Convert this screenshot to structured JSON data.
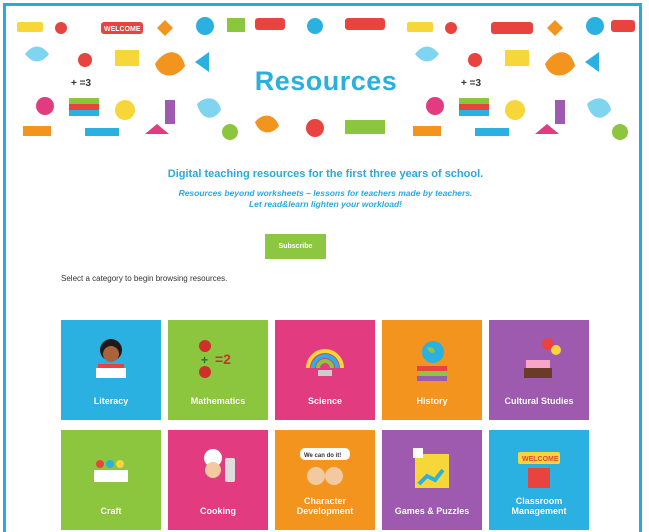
{
  "banner": {
    "title": "Resources",
    "stickers": [
      "WELCOME",
      "WELCOME",
      "WELCOME",
      "WELCOME",
      "WELCOME",
      "WELCOME"
    ],
    "brand": "read&learn"
  },
  "intro": {
    "tagline": "Digital teaching resources for the first three years of school.",
    "subtag_line1": "Resources beyond worksheets – lessons for teachers made by teachers.",
    "subtag_line2": "Let read&learn lighten your workload!"
  },
  "subscribe_label": "Subscribe",
  "select_prompt": "Select a category to begin browsing resources.",
  "categories": [
    {
      "label": "Literacy",
      "color": "#2bb0e2",
      "icon": "reading-child-icon"
    },
    {
      "label": "Mathematics",
      "color": "#8cc63e",
      "icon": "ladybug-math-icon"
    },
    {
      "label": "Science",
      "color": "#e23b7f",
      "icon": "rainbow-magnet-icon"
    },
    {
      "label": "History",
      "color": "#f2941d",
      "icon": "globe-books-icon"
    },
    {
      "label": "Cultural Studies",
      "color": "#9d5aaf",
      "icon": "cake-balloons-icon"
    },
    {
      "label": "Craft",
      "color": "#8cc63e",
      "icon": "scissors-paint-icon"
    },
    {
      "label": "Cooking",
      "color": "#e23b7f",
      "icon": "chef-icon"
    },
    {
      "label": "Character Development",
      "color": "#f2941d",
      "icon": "speech-bubble-kids-icon"
    },
    {
      "label": "Games & Puzzles",
      "color": "#9d5aaf",
      "icon": "board-game-icon"
    },
    {
      "label": "Classroom Management",
      "color": "#2bb0e2",
      "icon": "welcome-sign-icon"
    }
  ],
  "math_glyph": "=2",
  "speech_text": "We can do it!",
  "welcome_sign": "WELCOME"
}
